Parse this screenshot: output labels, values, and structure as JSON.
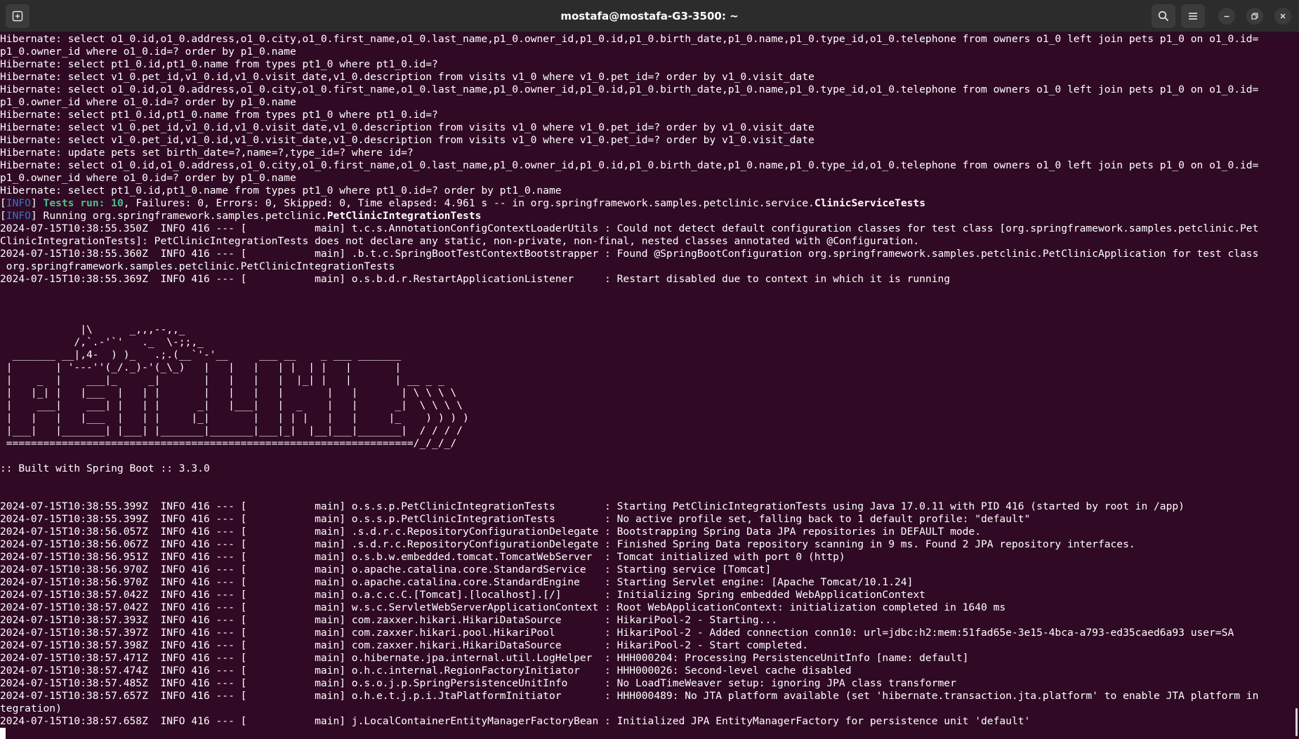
{
  "window": {
    "title": "mostafa@mostafa-G3-3500: ~"
  },
  "icons": {
    "new_tab": "new-tab-icon",
    "search": "search-icon",
    "menu": "hamburger-menu-icon",
    "minimize": "minimize-icon",
    "maximize": "maximize-icon",
    "close": "close-icon"
  },
  "colors": {
    "terminal_bg": "#300a24",
    "titlebar_bg": "#2c2c2c",
    "info_tag": "#3a73c4",
    "tests_green": "#4ec08a"
  },
  "hibernate_lines": [
    "Hibernate: select o1_0.id,o1_0.address,o1_0.city,o1_0.first_name,o1_0.last_name,p1_0.owner_id,p1_0.id,p1_0.birth_date,p1_0.name,p1_0.type_id,o1_0.telephone from owners o1_0 left join pets p1_0 on o1_0.id=",
    "p1_0.owner_id where o1_0.id=? order by p1_0.name",
    "Hibernate: select pt1_0.id,pt1_0.name from types pt1_0 where pt1_0.id=?",
    "Hibernate: select v1_0.pet_id,v1_0.id,v1_0.visit_date,v1_0.description from visits v1_0 where v1_0.pet_id=? order by v1_0.visit_date",
    "Hibernate: select o1_0.id,o1_0.address,o1_0.city,o1_0.first_name,o1_0.last_name,p1_0.owner_id,p1_0.id,p1_0.birth_date,p1_0.name,p1_0.type_id,o1_0.telephone from owners o1_0 left join pets p1_0 on o1_0.id=",
    "p1_0.owner_id where o1_0.id=? order by p1_0.name",
    "Hibernate: select pt1_0.id,pt1_0.name from types pt1_0 where pt1_0.id=?",
    "Hibernate: select v1_0.pet_id,v1_0.id,v1_0.visit_date,v1_0.description from visits v1_0 where v1_0.pet_id=? order by v1_0.visit_date",
    "Hibernate: select v1_0.pet_id,v1_0.id,v1_0.visit_date,v1_0.description from visits v1_0 where v1_0.pet_id=? order by v1_0.visit_date",
    "Hibernate: update pets set birth_date=?,name=?,type_id=? where id=?",
    "Hibernate: select o1_0.id,o1_0.address,o1_0.city,o1_0.first_name,o1_0.last_name,p1_0.owner_id,p1_0.id,p1_0.birth_date,p1_0.name,p1_0.type_id,o1_0.telephone from owners o1_0 left join pets p1_0 on o1_0.id=",
    "p1_0.owner_id where o1_0.id=? order by p1_0.name",
    "Hibernate: select pt1_0.id,pt1_0.name from types pt1_0 where pt1_0.id=? order by pt1_0.name"
  ],
  "tests_result": {
    "bracket_open": "[",
    "tag": "INFO",
    "bracket_close": "] ",
    "tests_run": "Tests run: 10",
    "rest": ", Failures: 0, Errors: 0, Skipped: 0, Time elapsed: 4.961 s -- in org.springframework.samples.petclinic.service.",
    "class": "ClinicServiceTests"
  },
  "running": {
    "bracket_open": "[",
    "tag": "INFO",
    "bracket_close": "] ",
    "prefix": "Running org.springframework.samples.petclinic.",
    "class": "PetClinicIntegrationTests"
  },
  "context_lines": [
    "2024-07-15T10:38:55.350Z  INFO 416 --- [           main] t.c.s.AnnotationConfigContextLoaderUtils : Could not detect default configuration classes for test class [org.springframework.samples.petclinic.Pet",
    "ClinicIntegrationTests]: PetClinicIntegrationTests does not declare any static, non-private, non-final, nested classes annotated with @Configuration.",
    "2024-07-15T10:38:55.360Z  INFO 416 --- [           main] .b.t.c.SpringBootTestContextBootstrapper : Found @SpringBootConfiguration org.springframework.samples.petclinic.PetClinicApplication for test class",
    " org.springframework.samples.petclinic.PetClinicIntegrationTests",
    "2024-07-15T10:38:55.369Z  INFO 416 --- [           main] o.s.b.d.r.RestartApplicationListener     : Restart disabled due to context in which it is running"
  ],
  "banner_lines": [
    "",
    "",
    "",
    "             |\\      _,,,--,,_",
    "            /,`.-'`'   ._  \\-;;,_",
    "  _______ __|,4-  ) )_   .;.(__`'-'__     ___ __    _ ___ _______",
    " |       | '---''(_/._)-'(_\\_)   |   |   |   | |  | |   |       |",
    " |    _  |    ___|_     _|       |   |   |   |  |_| |   |       | __ _ _",
    " |   |_| |   |___  |   | |       |   |   |   |       |   |       | \\ \\ \\ \\",
    " |    ___|    ___| |   | |      _|   |___|   |  _    |   |      _|  \\ \\ \\ \\",
    " |   |   |   |___  |   | |     |_|       |   | | |   |   |     |_    ) ) ) )",
    " |___|   |_______| |___| |_______|_______|___|_|  |__|___|_______|  / / / /",
    " ==================================================================/_/_/_/",
    "",
    ":: Built with Spring Boot :: 3.3.0",
    "",
    ""
  ],
  "startup_lines": [
    "2024-07-15T10:38:55.399Z  INFO 416 --- [           main] o.s.s.p.PetClinicIntegrationTests        : Starting PetClinicIntegrationTests using Java 17.0.11 with PID 416 (started by root in /app)",
    "2024-07-15T10:38:55.399Z  INFO 416 --- [           main] o.s.s.p.PetClinicIntegrationTests        : No active profile set, falling back to 1 default profile: \"default\"",
    "2024-07-15T10:38:56.057Z  INFO 416 --- [           main] .s.d.r.c.RepositoryConfigurationDelegate : Bootstrapping Spring Data JPA repositories in DEFAULT mode.",
    "2024-07-15T10:38:56.067Z  INFO 416 --- [           main] .s.d.r.c.RepositoryConfigurationDelegate : Finished Spring Data repository scanning in 9 ms. Found 2 JPA repository interfaces.",
    "2024-07-15T10:38:56.951Z  INFO 416 --- [           main] o.s.b.w.embedded.tomcat.TomcatWebServer  : Tomcat initialized with port 0 (http)",
    "2024-07-15T10:38:56.970Z  INFO 416 --- [           main] o.apache.catalina.core.StandardService   : Starting service [Tomcat]",
    "2024-07-15T10:38:56.970Z  INFO 416 --- [           main] o.apache.catalina.core.StandardEngine    : Starting Servlet engine: [Apache Tomcat/10.1.24]",
    "2024-07-15T10:38:57.042Z  INFO 416 --- [           main] o.a.c.c.C.[Tomcat].[localhost].[/]       : Initializing Spring embedded WebApplicationContext",
    "2024-07-15T10:38:57.042Z  INFO 416 --- [           main] w.s.c.ServletWebServerApplicationContext : Root WebApplicationContext: initialization completed in 1640 ms",
    "2024-07-15T10:38:57.393Z  INFO 416 --- [           main] com.zaxxer.hikari.HikariDataSource       : HikariPool-2 - Starting...",
    "2024-07-15T10:38:57.397Z  INFO 416 --- [           main] com.zaxxer.hikari.pool.HikariPool        : HikariPool-2 - Added connection conn10: url=jdbc:h2:mem:51fad65e-3e15-4bca-a793-ed35caed6a93 user=SA",
    "2024-07-15T10:38:57.398Z  INFO 416 --- [           main] com.zaxxer.hikari.HikariDataSource       : HikariPool-2 - Start completed.",
    "2024-07-15T10:38:57.471Z  INFO 416 --- [           main] o.hibernate.jpa.internal.util.LogHelper  : HHH000204: Processing PersistenceUnitInfo [name: default]",
    "2024-07-15T10:38:57.474Z  INFO 416 --- [           main] o.h.c.internal.RegionFactoryInitiator    : HHH000026: Second-level cache disabled",
    "2024-07-15T10:38:57.485Z  INFO 416 --- [           main] o.s.o.j.p.SpringPersistenceUnitInfo      : No LoadTimeWeaver setup: ignoring JPA class transformer",
    "2024-07-15T10:38:57.657Z  INFO 416 --- [           main] o.h.e.t.j.p.i.JtaPlatformInitiator       : HHH000489: No JTA platform available (set 'hibernate.transaction.jta.platform' to enable JTA platform in",
    "tegration)",
    "2024-07-15T10:38:57.658Z  INFO 416 --- [           main] j.LocalContainerEntityManagerFactoryBean : Initialized JPA EntityManagerFactory for persistence unit 'default'"
  ]
}
